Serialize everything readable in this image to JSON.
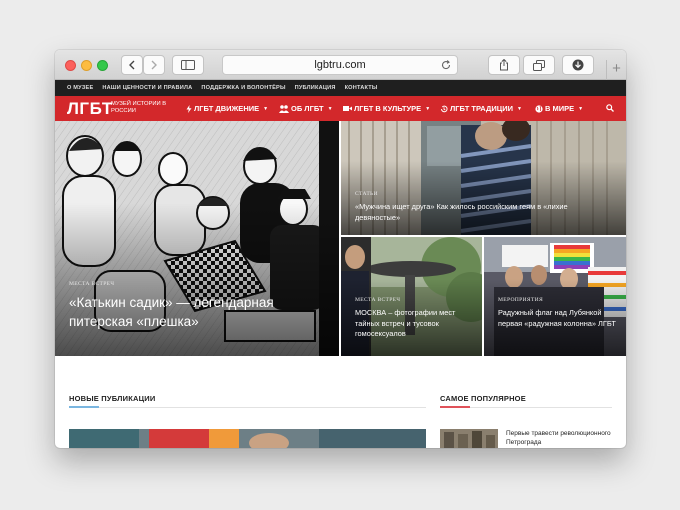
{
  "browser": {
    "url": "lgbtru.com"
  },
  "topbar": {
    "items": [
      "О МУЗЕЕ",
      "НАШИ ЦЕННОСТИ И ПРАВИЛА",
      "ПОДДЕРЖКА И ВОЛОНТЁРЫ",
      "ПУБЛИКАЦИЯ",
      "КОНТАКТЫ"
    ]
  },
  "nav": {
    "logo": "ЛГБТ",
    "logo_sub": "МУЗЕЙ ИСТОРИИ В РОССИИ",
    "items": [
      {
        "label": "ЛГБТ ДВИЖЕНИЕ",
        "icon": "lightning-icon"
      },
      {
        "label": "ОБ ЛГБТ",
        "icon": "people-icon"
      },
      {
        "label": "ЛГБТ В КУЛЬТУРЕ",
        "icon": "video-camera-icon"
      },
      {
        "label": "ЛГБТ ТРАДИЦИИ",
        "icon": "history-icon"
      },
      {
        "label": "В МИРЕ",
        "icon": "globe-icon"
      }
    ]
  },
  "hero": {
    "main": {
      "category": "МЕСТА ВСТРЕЧ",
      "title": "«Катькин садик» — легендарная питерская «плешка»"
    },
    "top_right": {
      "category": "СТАТЬИ",
      "title": "«Мужчина ищет друга» Как жилось российским геям в «лихие девяностые»"
    },
    "bottom_left": {
      "category": "МЕСТА ВСТРЕЧ",
      "title": "МОСКВА – фотографии мест тайных встреч и тусовок гомосексуалов"
    },
    "bottom_right": {
      "category": "МЕРОПРИЯТИЯ",
      "title": "Радужный флаг над Лубянкой первая «радужная колонна» ЛГБТ"
    }
  },
  "sections": {
    "new_label": "НОВЫЕ ПУБЛИКАЦИИ",
    "popular_label": "САМОЕ ПОПУЛЯРНОЕ",
    "popular_first": "Первые травести революционного Петрограда"
  },
  "colors": {
    "brand_red": "#d3282b",
    "accent_blue": "#7ab6e0",
    "accent_red": "#e0525a"
  }
}
